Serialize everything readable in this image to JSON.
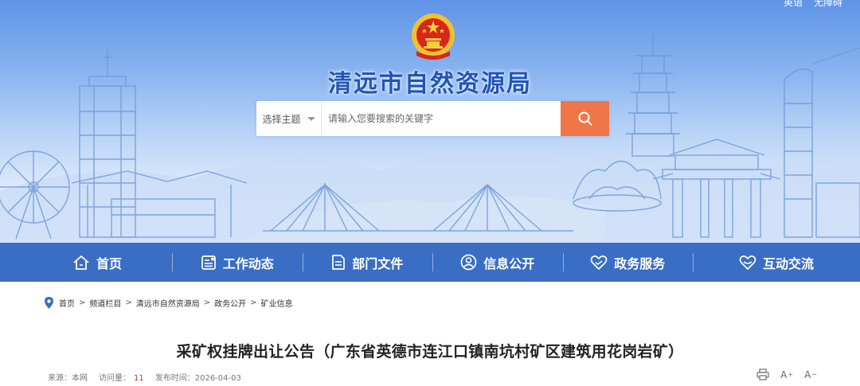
{
  "header": {
    "top_links": [
      "英语",
      "无障碍"
    ],
    "site_title": "清远市自然资源局"
  },
  "search": {
    "select_label": "选择主题",
    "placeholder": "请输入您要搜索的关键字"
  },
  "nav": {
    "items": [
      {
        "label": "首页",
        "icon": "home-icon"
      },
      {
        "label": "工作动态",
        "icon": "news-icon"
      },
      {
        "label": "部门文件",
        "icon": "document-icon"
      },
      {
        "label": "信息公开",
        "icon": "person-info-icon"
      },
      {
        "label": "政务服务",
        "icon": "service-heart-icon"
      },
      {
        "label": "互动交流",
        "icon": "interaction-heart-icon"
      }
    ]
  },
  "breadcrumb": {
    "items": [
      "首页",
      "频道栏目",
      "清远市自然资源局",
      "政务公开",
      "矿业信息"
    ],
    "separator": ">"
  },
  "article": {
    "title": "采矿权挂牌出让公告（广东省英德市连江口镇南坑村矿区建筑用花岗岩矿）",
    "source_label": "来源：本网",
    "views_label": "访问量：",
    "views_count": "11",
    "date_label": "发布时间：2026-04-03"
  },
  "tools": {
    "increase_font": "A",
    "decrease_font": "A"
  },
  "colors": {
    "nav_bg": "#3a6ec4",
    "search_button": "#f07547",
    "title_blue": "#1f55b8",
    "views_count": "#c9302c"
  }
}
